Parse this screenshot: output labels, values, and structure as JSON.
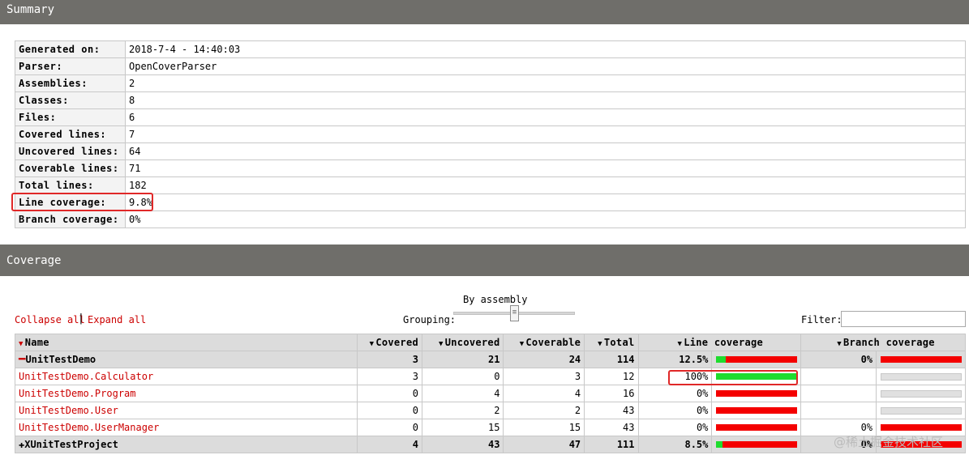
{
  "summary_header": "Summary",
  "summary": {
    "rows": [
      {
        "key": "Generated on:",
        "value": "2018-7-4 - 14:40:03"
      },
      {
        "key": "Parser:",
        "value": "OpenCoverParser"
      },
      {
        "key": "Assemblies:",
        "value": "2"
      },
      {
        "key": "Classes:",
        "value": "8"
      },
      {
        "key": "Files:",
        "value": "6"
      },
      {
        "key": "Covered lines:",
        "value": "7"
      },
      {
        "key": "Uncovered lines:",
        "value": "64"
      },
      {
        "key": "Coverable lines:",
        "value": "71"
      },
      {
        "key": "Total lines:",
        "value": "182"
      },
      {
        "key": "Line coverage:",
        "value": "9.8%"
      },
      {
        "key": "Branch coverage:",
        "value": "0%"
      }
    ]
  },
  "coverage_header": "Coverage",
  "controls": {
    "collapse_all": "Collapse all",
    "separator": "|",
    "expand_all": "Expand all",
    "grouping_label": "Grouping:",
    "grouping_value": "By assembly",
    "filter_label": "Filter:",
    "filter_value": ""
  },
  "columns": {
    "name": "Name",
    "covered": "Covered",
    "uncovered": "Uncovered",
    "coverable": "Coverable",
    "total": "Total",
    "line_coverage": "Line coverage",
    "branch_coverage": "Branch coverage"
  },
  "rows": [
    {
      "type": "assembly",
      "toggle": "minus",
      "name": "UnitTestDemo",
      "covered": "3",
      "uncovered": "21",
      "coverable": "24",
      "total": "114",
      "line_pct": "12.5%",
      "line_fraction": 0.125,
      "branch_pct": "0%",
      "branch_fraction": 0
    },
    {
      "type": "class",
      "name": "UnitTestDemo.Calculator",
      "covered": "3",
      "uncovered": "0",
      "coverable": "3",
      "total": "12",
      "line_pct": "100%",
      "line_fraction": 1.0,
      "branch_pct": "",
      "branch_fraction": null
    },
    {
      "type": "class",
      "name": "UnitTestDemo.Program",
      "covered": "0",
      "uncovered": "4",
      "coverable": "4",
      "total": "16",
      "line_pct": "0%",
      "line_fraction": 0,
      "branch_pct": "",
      "branch_fraction": null
    },
    {
      "type": "class",
      "name": "UnitTestDemo.User",
      "covered": "0",
      "uncovered": "2",
      "coverable": "2",
      "total": "43",
      "line_pct": "0%",
      "line_fraction": 0,
      "branch_pct": "",
      "branch_fraction": null
    },
    {
      "type": "class",
      "name": "UnitTestDemo.UserManager",
      "covered": "0",
      "uncovered": "15",
      "coverable": "15",
      "total": "43",
      "line_pct": "0%",
      "line_fraction": 0,
      "branch_pct": "0%",
      "branch_fraction": 0
    },
    {
      "type": "assembly",
      "toggle": "plus",
      "name": "XUnitTestProject",
      "covered": "4",
      "uncovered": "43",
      "coverable": "47",
      "total": "111",
      "line_pct": "8.5%",
      "line_fraction": 0.085,
      "branch_pct": "0%",
      "branch_fraction": 0
    }
  ],
  "watermark": "@稀土掘金技术社区",
  "colors": {
    "covered": "#1fdc2e",
    "uncovered": "#f40000",
    "highlight": "#e02828"
  }
}
